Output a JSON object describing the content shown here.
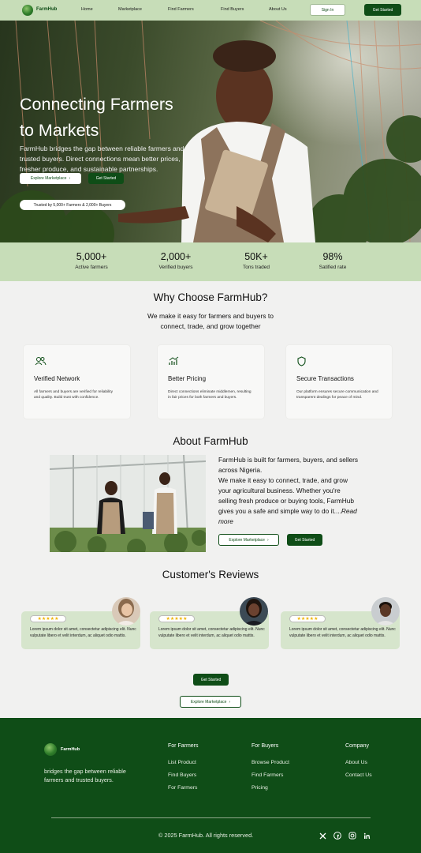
{
  "brand": "FarmHub",
  "nav": {
    "links": [
      "Home",
      "Marketplace",
      "Find Farmers",
      "Find Buyers",
      "About Us"
    ],
    "sign_in": "Sign In",
    "get_started": "Get Started"
  },
  "hero": {
    "title_line1": "Connecting Farmers",
    "title_line2": "to Markets",
    "text": "FarmHub bridges the gap between reliable farmers and trusted buyers. Direct connections mean better prices, fresher produce, and sustainable partnerships.",
    "explore": "Explore Marketplace",
    "get_started": "Get Started",
    "trusted": "Trusted by 5,000+ Farmers & 2,000+ Buyers"
  },
  "stats": [
    {
      "value": "5,000+",
      "label": "Active farmers"
    },
    {
      "value": "2,000+",
      "label": "Verified buyers"
    },
    {
      "value": "50K+",
      "label": "Tons traded"
    },
    {
      "value": "98%",
      "label": "Satified rate"
    }
  ],
  "why": {
    "title": "Why Choose FarmHub?",
    "subtitle_line1": "We make it easy for farmers and buyers to",
    "subtitle_line2": "connect, trade, and grow together",
    "cards": [
      {
        "icon": "users-icon",
        "title": "Verified Network",
        "text": "All farmers and buyers are verified for reliability and quality. Build trust with confidence."
      },
      {
        "icon": "chart-up-icon",
        "title": "Better Pricing",
        "text": "Direct connections eliminate middlemen, resulting in fair prices for both farmers and buyers."
      },
      {
        "icon": "shield-icon",
        "title": "Secure Transactions",
        "text": "Our platform ensures secure communication and transparent dealings for peace of mind."
      }
    ]
  },
  "about": {
    "title": "About FarmHub",
    "p1": "FarmHub is built for farmers, buyers, and sellers across Nigeria.",
    "p2": "We make it easy to connect, trade, and grow your agricultural business. Whether you're selling fresh produce or buying tools, FarmHub gives you a safe and simple way to do it....",
    "read_more": "Read more",
    "explore": "Explore Marketplace",
    "get_started": "Get Started"
  },
  "reviews": {
    "title": "Customer's Reviews",
    "items": [
      {
        "stars": "★★★★★",
        "text": "Lorem ipsum dolor sit amet, consectetur adipiscing elit. Nunc vulputate libero et velit interdum, ac aliquet odio mattis."
      },
      {
        "stars": "★★★★★",
        "text": "Lorem ipsum dolor sit amet, consectetur adipiscing elit. Nunc vulputate libero et velit interdum, ac aliquet odio mattis."
      },
      {
        "stars": "★★★★★",
        "text": "Lorem ipsum dolor sit amet, consectetur adipiscing elit. Nunc vulputate libero et velit interdum, ac aliquet odio mattis."
      }
    ]
  },
  "cta": {
    "get_started": "Get Started",
    "explore": "Explore Marketplace"
  },
  "footer": {
    "tagline": "bridges the gap between reliable farmers and trusted buyers.",
    "farmers": {
      "heading": "For Farmers",
      "links": [
        "List Product",
        "Find Buyers",
        "For Farmers"
      ]
    },
    "buyers": {
      "heading": "For Buyers",
      "links": [
        "Browse Product",
        "Find Farmers",
        "Pricing"
      ]
    },
    "company": {
      "heading": "Company",
      "links": [
        "About Us",
        "Contact Us"
      ]
    },
    "copyright": "© 2025 FarmHub. All rights reserved."
  },
  "colors": {
    "primary": "#0f4d17",
    "mint": "#c7ddb8",
    "page": "#f1f1f0",
    "review": "#d6e5cc"
  }
}
